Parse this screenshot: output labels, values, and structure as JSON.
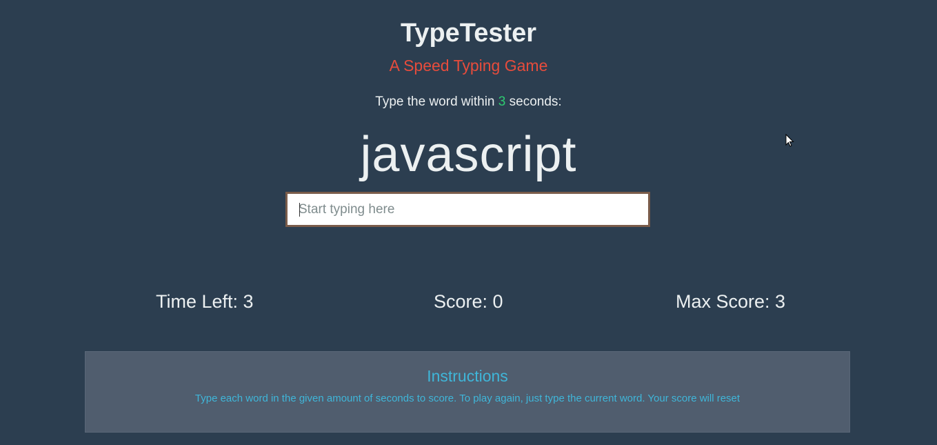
{
  "header": {
    "title": "TypeTester",
    "subtitle": "A Speed Typing Game"
  },
  "prompt": {
    "prefix": "Type the word within ",
    "seconds": "3",
    "suffix": " seconds:"
  },
  "game": {
    "current_word": "javascript",
    "input_placeholder": "Start typing here",
    "input_value": ""
  },
  "stats": {
    "time_left": "Time Left: 3",
    "score": "Score: 0",
    "max_score": "Max Score: 3"
  },
  "instructions": {
    "title": "Instructions",
    "text": "Type each word in the given amount of seconds to score. To play again, just type the current word. Your score will reset"
  },
  "colors": {
    "background": "#2c3e50",
    "title": "#ecf0f1",
    "subtitle": "#e74c3c",
    "seconds": "#2ecc71",
    "instructions_bg": "#505d6e",
    "instructions_text": "#3fb6d9"
  },
  "icons": {
    "cursor": "mouse-pointer-icon"
  }
}
